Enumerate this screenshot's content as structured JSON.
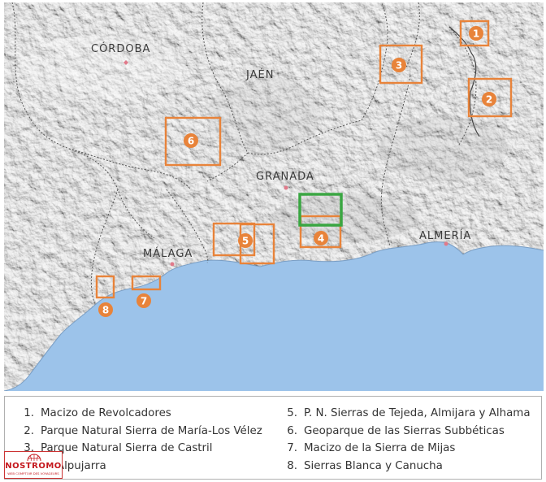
{
  "cities": [
    {
      "id": "cordoba",
      "name": "CÓRDOBA"
    },
    {
      "id": "jaen",
      "name": "JAÉN"
    },
    {
      "id": "granada",
      "name": "GRANADA"
    },
    {
      "id": "malaga",
      "name": "MÁLAGA"
    },
    {
      "id": "almeria",
      "name": "ALMERÍA"
    }
  ],
  "markers": [
    {
      "number": "1",
      "color": "#e8833a"
    },
    {
      "number": "2",
      "color": "#e8833a"
    },
    {
      "number": "3",
      "color": "#e8833a"
    },
    {
      "number": "4",
      "color": "#e8833a"
    },
    {
      "number": "5",
      "color": "#e8833a"
    },
    {
      "number": "6",
      "color": "#e8833a"
    },
    {
      "number": "7",
      "color": "#e8833a"
    },
    {
      "number": "8",
      "color": "#e8833a"
    }
  ],
  "highlight_color": "#3aa642",
  "sea_color": "#9cc3ea",
  "land_color": "#e6e6e6",
  "legend": {
    "left": [
      {
        "num": "1.",
        "text": "Macizo de Revolcadores"
      },
      {
        "num": "2.",
        "text": "Parque Natural Sierra de María-Los Vélez"
      },
      {
        "num": "3.",
        "text": "Parque Natural Sierra de Castril"
      },
      {
        "num": "4.",
        "text": "La Alpujarra"
      }
    ],
    "right": [
      {
        "num": "5.",
        "text": "P. N. Sierras de Tejeda, Almijara y Alhama"
      },
      {
        "num": "6.",
        "text": "Geoparque de las Sierras Subbéticas"
      },
      {
        "num": "7.",
        "text": "Macizo de la Sierra de Mijas"
      },
      {
        "num": "8.",
        "text": "Sierras Blanca y Canucha"
      }
    ]
  },
  "logo": {
    "brand": "NOSTROMO",
    "tagline": "WEB COMPTOIR DES VOYAGEURS",
    "icon": "globe-icon"
  }
}
